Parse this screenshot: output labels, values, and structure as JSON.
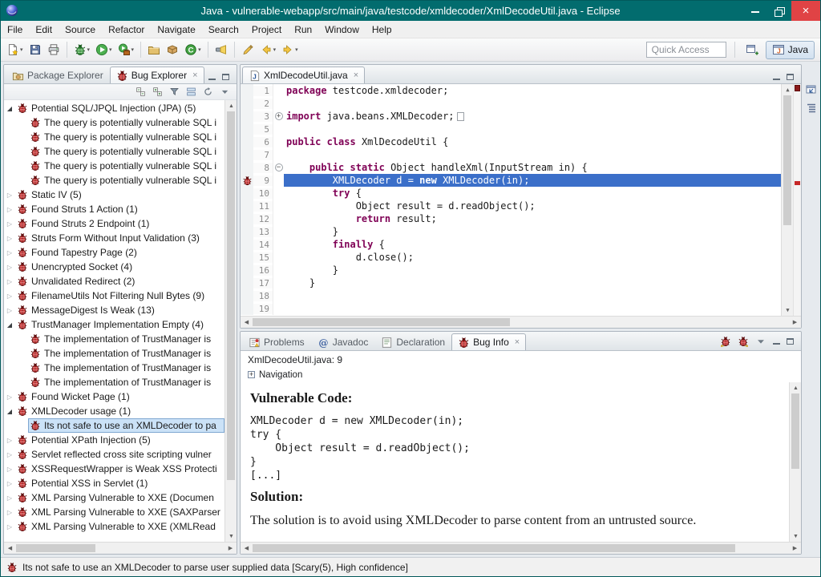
{
  "window": {
    "title": "Java - vulnerable-webapp/src/main/java/testcode/xmldecoder/XmlDecodeUtil.java - Eclipse"
  },
  "icons": {
    "close": "×",
    "dropdown": "▾",
    "scroll_up": "▲",
    "scroll_down": "▼",
    "scroll_left": "◀",
    "scroll_right": "▶",
    "collapsed_arrow": "▷",
    "expanded_arrow": "◢",
    "fold_plus": "+",
    "fold_minus": "−",
    "nav_plus": "+"
  },
  "menubar": {
    "items": [
      "File",
      "Edit",
      "Source",
      "Refactor",
      "Navigate",
      "Search",
      "Project",
      "Run",
      "Window",
      "Help"
    ]
  },
  "toolbar": {
    "buttons": [
      {
        "name": "new-wizard",
        "dropdown": true
      },
      {
        "name": "save"
      },
      {
        "name": "print"
      },
      {
        "sep": true
      },
      {
        "name": "debug",
        "dropdown": true
      },
      {
        "name": "run",
        "dropdown": true
      },
      {
        "name": "external-tools",
        "dropdown": true
      },
      {
        "sep": true
      },
      {
        "name": "new-java-project"
      },
      {
        "name": "new-package"
      },
      {
        "name": "new-class",
        "dropdown": true
      },
      {
        "sep": true
      },
      {
        "name": "search"
      },
      {
        "sep": true
      },
      {
        "name": "last-edit-location"
      },
      {
        "name": "back",
        "dropdown": true
      },
      {
        "name": "forward",
        "dropdown": true
      }
    ],
    "quick_access_label": "Quick Access",
    "perspective_label": "Java"
  },
  "left_panel": {
    "tabs": [
      {
        "label": "Package Explorer",
        "icon": "package-explorer",
        "active": false
      },
      {
        "label": "Bug Explorer",
        "icon": "bug",
        "active": true,
        "closable": true
      }
    ],
    "view_toolbar": [
      "collapse-all",
      "expand-all",
      "filter",
      "group",
      "refresh",
      "view-menu"
    ],
    "tree": [
      {
        "level": 0,
        "children": true,
        "expanded": true,
        "label": "Potential SQL/JPQL Injection (JPA) (5)"
      },
      {
        "level": 1,
        "label": "The query is potentially vulnerable SQL i"
      },
      {
        "level": 1,
        "label": "The query is potentially vulnerable SQL i"
      },
      {
        "level": 1,
        "label": "The query is potentially vulnerable SQL i"
      },
      {
        "level": 1,
        "label": "The query is potentially vulnerable SQL i"
      },
      {
        "level": 1,
        "label": "The query is potentially vulnerable SQL i"
      },
      {
        "level": 0,
        "children": true,
        "label": "Static IV (5)"
      },
      {
        "level": 0,
        "children": true,
        "label": "Found Struts 1 Action (1)"
      },
      {
        "level": 0,
        "children": true,
        "label": "Found Struts 2 Endpoint (1)"
      },
      {
        "level": 0,
        "children": true,
        "label": "Struts Form Without Input Validation (3)"
      },
      {
        "level": 0,
        "children": true,
        "label": "Found Tapestry Page (2)"
      },
      {
        "level": 0,
        "children": true,
        "label": "Unencrypted Socket (4)"
      },
      {
        "level": 0,
        "children": true,
        "label": "Unvalidated Redirect (2)"
      },
      {
        "level": 0,
        "children": true,
        "label": "FilenameUtils Not Filtering Null Bytes (9)"
      },
      {
        "level": 0,
        "children": true,
        "label": "MessageDigest Is Weak (13)"
      },
      {
        "level": 0,
        "children": true,
        "expanded": true,
        "label": "TrustManager Implementation Empty (4)"
      },
      {
        "level": 1,
        "label": "The implementation of TrustManager is"
      },
      {
        "level": 1,
        "label": "The implementation of TrustManager is"
      },
      {
        "level": 1,
        "label": "The implementation of TrustManager is"
      },
      {
        "level": 1,
        "label": "The implementation of TrustManager is"
      },
      {
        "level": 0,
        "children": true,
        "label": "Found Wicket Page (1)"
      },
      {
        "level": 0,
        "children": true,
        "expanded": true,
        "label": "XMLDecoder usage (1)"
      },
      {
        "level": 1,
        "selected": true,
        "label": "Its not safe to use an XMLDecoder to pa"
      },
      {
        "level": 0,
        "children": true,
        "label": "Potential XPath Injection (5)"
      },
      {
        "level": 0,
        "children": true,
        "label": "Servlet reflected cross site scripting vulner"
      },
      {
        "level": 0,
        "children": true,
        "label": "XSSRequestWrapper is Weak XSS Protecti"
      },
      {
        "level": 0,
        "children": true,
        "label": "Potential XSS in Servlet (1)"
      },
      {
        "level": 0,
        "children": true,
        "label": "XML Parsing Vulnerable to XXE (Documen"
      },
      {
        "level": 0,
        "children": true,
        "label": "XML Parsing Vulnerable to XXE (SAXParser"
      },
      {
        "level": 0,
        "children": true,
        "label": "XML Parsing Vulnerable to XXE (XMLRead"
      }
    ]
  },
  "editor": {
    "tabs": [
      {
        "label": "XmlDecodeUtil.java",
        "icon": "java-file",
        "active": true,
        "closable": true
      }
    ],
    "lines": [
      {
        "num": "1",
        "segs": [
          {
            "t": "package",
            "k": true
          },
          {
            "t": " testcode.xmldecoder;"
          }
        ]
      },
      {
        "num": "2",
        "segs": []
      },
      {
        "num": "3",
        "fold": "plus",
        "segs": [
          {
            "t": "import",
            "k": true
          },
          {
            "t": " java.beans.XMLDecoder;"
          },
          {
            "box": true
          }
        ]
      },
      {
        "num": "5",
        "segs": []
      },
      {
        "num": "6",
        "segs": [
          {
            "t": "public",
            "k": true
          },
          {
            "t": " "
          },
          {
            "t": "class",
            "k": true
          },
          {
            "t": " XmlDecodeUtil {"
          }
        ]
      },
      {
        "num": "7",
        "segs": []
      },
      {
        "num": "8",
        "fold": "minus",
        "segs": [
          {
            "t": "    "
          },
          {
            "t": "public",
            "k": true
          },
          {
            "t": " "
          },
          {
            "t": "static",
            "k": true
          },
          {
            "t": " Object handleXml(InputStream in) {"
          }
        ]
      },
      {
        "num": "9",
        "selected": true,
        "bug": true,
        "segs": [
          {
            "t": "        XMLDecoder d = "
          },
          {
            "t": "new",
            "k": true
          },
          {
            "t": " XMLDecoder(in);"
          }
        ]
      },
      {
        "num": "10",
        "segs": [
          {
            "t": "        "
          },
          {
            "t": "try",
            "k": true
          },
          {
            "t": " {"
          }
        ]
      },
      {
        "num": "11",
        "segs": [
          {
            "t": "            Object result = d.readObject();"
          }
        ]
      },
      {
        "num": "12",
        "segs": [
          {
            "t": "            "
          },
          {
            "t": "return",
            "k": true
          },
          {
            "t": " result;"
          }
        ]
      },
      {
        "num": "13",
        "segs": [
          {
            "t": "        }"
          }
        ]
      },
      {
        "num": "14",
        "segs": [
          {
            "t": "        "
          },
          {
            "t": "finally",
            "k": true
          },
          {
            "t": " {"
          }
        ]
      },
      {
        "num": "15",
        "segs": [
          {
            "t": "            d.close();"
          }
        ]
      },
      {
        "num": "16",
        "segs": [
          {
            "t": "        }"
          }
        ]
      },
      {
        "num": "17",
        "segs": [
          {
            "t": "    }"
          }
        ]
      },
      {
        "num": "18",
        "segs": []
      },
      {
        "num": "19",
        "segs": []
      }
    ]
  },
  "bottom_panel": {
    "tabs": [
      {
        "label": "Problems",
        "icon": "problems"
      },
      {
        "label": "Javadoc",
        "icon": "javadoc"
      },
      {
        "label": "Declaration",
        "icon": "declaration"
      },
      {
        "label": "Bug Info",
        "icon": "bug",
        "active": true,
        "closable": true
      }
    ],
    "header": "XmlDecodeUtil.java: 9",
    "navigation_label": "Navigation",
    "vulnerable_code_heading": "Vulnerable Code:",
    "vulnerable_code": [
      "XMLDecoder d = new XMLDecoder(in);",
      "try {",
      "    Object result = d.readObject();",
      "}",
      "[...]"
    ],
    "solution_heading": "Solution:",
    "solution_text": "The solution is to avoid using XMLDecoder to parse content from an untrusted source."
  },
  "statusbar": {
    "text": "Its not safe to use an XMLDecoder to parse user supplied data [Scary(5), High confidence]"
  }
}
